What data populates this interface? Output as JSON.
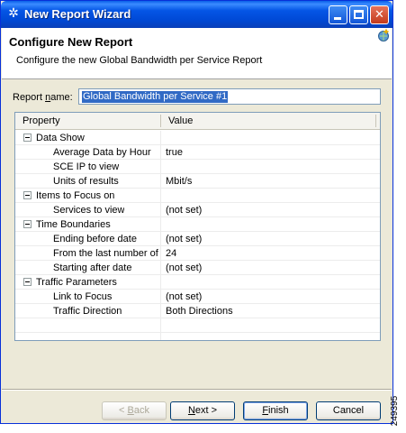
{
  "window": {
    "title": "New Report Wizard",
    "icon": "app-icon",
    "controls": {
      "minimize": "minimize-icon",
      "maximize": "maximize-icon",
      "close": "close-icon"
    }
  },
  "header": {
    "title": "Configure New Report",
    "description": "Configure the new Global Bandwidth per Service Report",
    "icon": "wizard-add-icon"
  },
  "report_name": {
    "label_pre": "Report ",
    "label_mnemonic": "n",
    "label_post": "ame:",
    "value": "Global Bandwidth per Service #1"
  },
  "grid": {
    "columns": [
      "Property",
      "Value"
    ],
    "rows": [
      {
        "type": "group",
        "property": "Data Show",
        "value": ""
      },
      {
        "type": "item",
        "property": "Average Data by Hour",
        "value": "true"
      },
      {
        "type": "item",
        "property": "SCE IP to view",
        "value": ""
      },
      {
        "type": "item",
        "property": "Units of results",
        "value": "Mbit/s"
      },
      {
        "type": "group",
        "property": "Items to Focus on",
        "value": ""
      },
      {
        "type": "item",
        "property": "Services to view",
        "value": "(not set)"
      },
      {
        "type": "group",
        "property": "Time Boundaries",
        "value": ""
      },
      {
        "type": "item",
        "property": "Ending before date",
        "value": "(not set)"
      },
      {
        "type": "item",
        "property": "From the last number of",
        "value": "24"
      },
      {
        "type": "item",
        "property": "Starting after date",
        "value": "(not set)"
      },
      {
        "type": "group",
        "property": "Traffic Parameters",
        "value": ""
      },
      {
        "type": "item",
        "property": "Link to Focus",
        "value": "(not set)"
      },
      {
        "type": "item",
        "property": "Traffic Direction",
        "value": "Both Directions"
      },
      {
        "type": "empty",
        "property": "",
        "value": ""
      },
      {
        "type": "empty",
        "property": "",
        "value": ""
      }
    ]
  },
  "buttons": {
    "back": {
      "prefix": "< ",
      "mnemonic": "B",
      "rest": "ack"
    },
    "next": {
      "mnemonic": "N",
      "rest": "ext >"
    },
    "finish": {
      "mnemonic": "F",
      "rest": "inish"
    },
    "cancel": {
      "label": "Cancel"
    }
  },
  "figure_id": "249395"
}
